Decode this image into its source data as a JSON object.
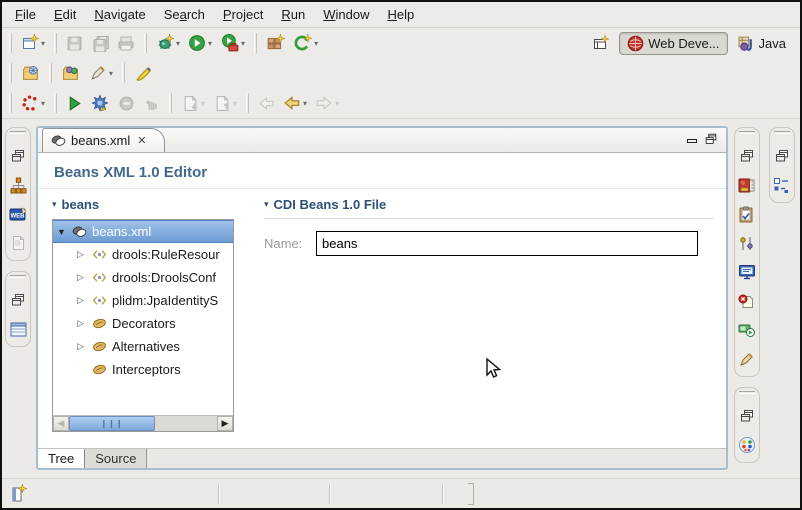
{
  "menu": {
    "items": [
      {
        "pre": "",
        "u": "F",
        "post": "ile"
      },
      {
        "pre": "",
        "u": "E",
        "post": "dit"
      },
      {
        "pre": "",
        "u": "N",
        "post": "avigate"
      },
      {
        "pre": "Se",
        "u": "a",
        "post": "rch"
      },
      {
        "pre": "",
        "u": "P",
        "post": "roject"
      },
      {
        "pre": "",
        "u": "R",
        "post": "un"
      },
      {
        "pre": "",
        "u": "W",
        "post": "indow"
      },
      {
        "pre": "",
        "u": "H",
        "post": "elp"
      }
    ]
  },
  "toolbar": {
    "row1_icons": [
      "new-wizard",
      "save",
      "save-all",
      "print",
      "debug",
      "run",
      "run-external-tools",
      "new-javaee-component",
      "refresh-c"
    ],
    "row2_icons": [
      "open-web-browser",
      "open-type",
      "mark-pen",
      "highlighter"
    ],
    "row3_icons": [
      "profile",
      "resume",
      "debug-launch",
      "terminate",
      "step",
      "next-annotation",
      "previous-annotation",
      "last-edit-location",
      "back",
      "forward"
    ],
    "perspective": {
      "open_icon": "open-perspective",
      "buttons": [
        {
          "label": "Web Deve...",
          "icon": "webdev-perspective-icon",
          "active": true
        },
        {
          "label": "Java",
          "icon": "java-perspective-icon",
          "active": false
        }
      ]
    }
  },
  "left_rail": {
    "groups": [
      [
        "restore-view",
        "hierarchy-view",
        "web-view",
        "notes-view"
      ],
      [
        "restore-view",
        "table-view"
      ]
    ]
  },
  "right_rail_inner": {
    "groups": [
      [
        "restore-view",
        "palette-view",
        "tasks-view",
        "properties-view",
        "console-view",
        "problems-view",
        "servers-view",
        "snippets-view"
      ],
      [
        "restore-view",
        "palette-colors-view"
      ]
    ]
  },
  "right_rail_outer": {
    "groups": [
      [
        "restore-view",
        "outline-view"
      ]
    ]
  },
  "editor": {
    "tab": {
      "label": "beans.xml"
    },
    "title": "Beans XML 1.0 Editor",
    "tree": {
      "header": "beans",
      "items": [
        {
          "label": "beans.xml",
          "state": "expanded",
          "selected": true
        },
        {
          "label": "drools:RuleResour",
          "state": "collapsed"
        },
        {
          "label": "drools:DroolsConf",
          "state": "collapsed"
        },
        {
          "label": "plidm:JpaIdentityS",
          "state": "collapsed"
        },
        {
          "label": "Decorators",
          "state": "collapsed"
        },
        {
          "label": "Alternatives",
          "state": "collapsed"
        },
        {
          "label": "Interceptors",
          "state": "leaf"
        }
      ]
    },
    "form": {
      "header": "CDI Beans 1.0 File",
      "name_label": "Name:",
      "name_value": "beans"
    },
    "bottom_tabs": [
      {
        "label": "Tree",
        "active": true
      },
      {
        "label": "Source",
        "active": false
      }
    ]
  },
  "statusbar": {
    "icon": "fast-view-new"
  },
  "colors": {
    "chrome": "#ECEAE6",
    "title_blue": "#44688C",
    "section_blue": "#2E5075",
    "selection_top": "#9EC1E9",
    "selection_bottom": "#6D9BD3",
    "editor_border": "#A9BDD1"
  }
}
